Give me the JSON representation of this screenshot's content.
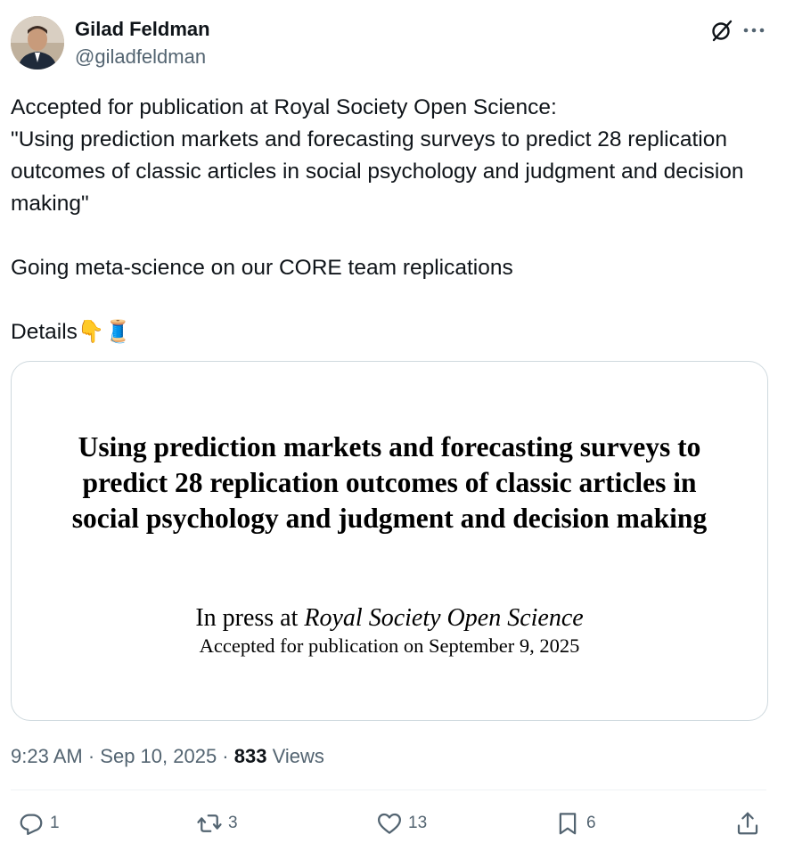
{
  "author": {
    "name": "Gilad Feldman",
    "handle": "@giladfeldman"
  },
  "icons": {
    "grok": "grok-icon",
    "more": "more-icon",
    "reply": "reply-icon",
    "retweet": "retweet-icon",
    "like": "heart-icon",
    "bookmark": "bookmark-icon",
    "share": "share-icon"
  },
  "post": {
    "line1": "Accepted for publication at Royal Society Open Science:",
    "line2": "\"Using prediction markets and forecasting surveys to predict 28 replication outcomes of classic articles in social psychology and judgment and decision making\"",
    "line3": "Going meta-science on our CORE team replications",
    "details": "Details",
    "emojis": "👇🧵"
  },
  "card": {
    "title": "Using prediction markets and forecasting surveys to predict 28 replication outcomes of classic articles in social psychology and judgment and decision making",
    "press_prefix": "In press at ",
    "press_journal": "Royal Society Open Science",
    "accepted": "Accepted for publication on September 9, 2025"
  },
  "meta": {
    "time": "9:23 AM",
    "sep": " · ",
    "date": "Sep 10, 2025",
    "views_count": "833",
    "views_label": "Views"
  },
  "actions": {
    "replies": "1",
    "retweets": "3",
    "likes": "13",
    "bookmarks": "6"
  },
  "colors": {
    "text": "#0f1419",
    "secondary": "#536471",
    "border": "#cfd9de"
  }
}
